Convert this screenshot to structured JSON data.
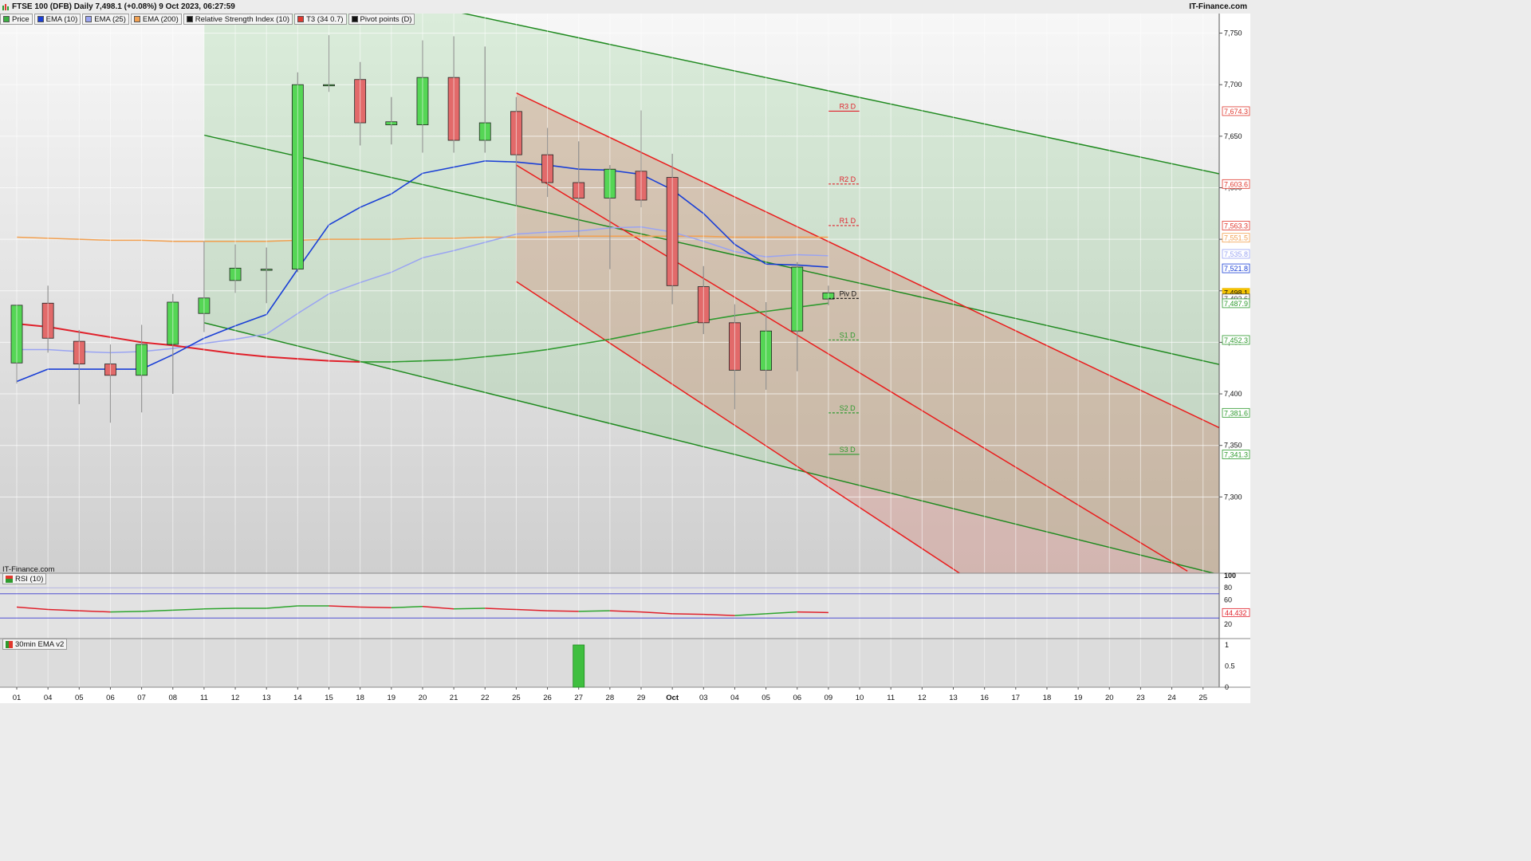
{
  "header": {
    "title": "FTSE 100 (DFB) Daily 7,498.1 (+0.08%) 9 Oct 2023, 06:27:59",
    "brand": "IT-Finance.com"
  },
  "legend": [
    {
      "label": "Price",
      "color": "#3cb043"
    },
    {
      "label": "EMA (10)",
      "color": "#1a3fd6"
    },
    {
      "label": "EMA (25)",
      "color": "#9aa4f2"
    },
    {
      "label": "EMA (200)",
      "color": "#f2a050"
    },
    {
      "label": "Relative Strength Index (10)",
      "color": "#111111"
    },
    {
      "label": "T3 (34 0.7)",
      "color": "#e0382e"
    },
    {
      "label": "Pivot points (D)",
      "color": "#111111"
    }
  ],
  "watermark": "IT-Finance.com",
  "colors": {
    "bull": "#55d655",
    "bear": "#e26a6a",
    "ema10": "#1a3fd6",
    "ema25": "#9aa4f2",
    "ema200": "#f2a050",
    "t3_up": "#2e9a2e",
    "t3_down": "#e0202a",
    "green_channel": "#1f8a1f",
    "red_channel": "#ea1c1c"
  },
  "chart_data": [
    {
      "type": "candlestick",
      "name": "price",
      "title": "FTSE 100 (DFB) Daily",
      "x_ticks": [
        "01",
        "04",
        "05",
        "06",
        "07",
        "08",
        "11",
        "12",
        "13",
        "14",
        "15",
        "18",
        "19",
        "20",
        "21",
        "22",
        "25",
        "26",
        "27",
        "28",
        "29",
        "Oct",
        "03",
        "04",
        "05",
        "06",
        "09",
        "10",
        "11",
        "12",
        "13",
        "16",
        "17",
        "18",
        "19",
        "20",
        "23",
        "24",
        "25"
      ],
      "y_ticks": [
        "7,300",
        "7,350",
        "7,400",
        "7,450",
        "7,500",
        "7,550",
        "7,600",
        "7,650",
        "7,700",
        "7,750"
      ],
      "ylim": [
        7226,
        7769
      ],
      "candles": [
        {
          "o": 7430,
          "h": 7470,
          "l": 7410,
          "c": 7486
        },
        {
          "o": 7488,
          "h": 7505,
          "l": 7440,
          "c": 7454
        },
        {
          "o": 7451,
          "h": 7462,
          "l": 7390,
          "c": 7429
        },
        {
          "o": 7429,
          "h": 7448,
          "l": 7372,
          "c": 7418
        },
        {
          "o": 7418,
          "h": 7467,
          "l": 7382,
          "c": 7448
        },
        {
          "o": 7448,
          "h": 7497,
          "l": 7400,
          "c": 7489
        },
        {
          "o": 7478,
          "h": 7548,
          "l": 7460,
          "c": 7493
        },
        {
          "o": 7510,
          "h": 7545,
          "l": 7498,
          "c": 7522
        },
        {
          "o": 7520,
          "h": 7542,
          "l": 7488,
          "c": 7521
        },
        {
          "o": 7521,
          "h": 7712,
          "l": 7518,
          "c": 7700
        },
        {
          "o": 7700,
          "h": 7748,
          "l": 7693,
          "c": 7700
        },
        {
          "o": 7705,
          "h": 7722,
          "l": 7641,
          "c": 7663
        },
        {
          "o": 7661,
          "h": 7688,
          "l": 7642,
          "c": 7664
        },
        {
          "o": 7661,
          "h": 7743,
          "l": 7634,
          "c": 7707
        },
        {
          "o": 7707,
          "h": 7747,
          "l": 7634,
          "c": 7646
        },
        {
          "o": 7646,
          "h": 7737,
          "l": 7634,
          "c": 7663
        },
        {
          "o": 7674,
          "h": 7688,
          "l": 7582,
          "c": 7632
        },
        {
          "o": 7632,
          "h": 7658,
          "l": 7591,
          "c": 7605
        },
        {
          "o": 7605,
          "h": 7645,
          "l": 7552,
          "c": 7590
        },
        {
          "o": 7590,
          "h": 7622,
          "l": 7521,
          "c": 7618
        },
        {
          "o": 7616,
          "h": 7675,
          "l": 7581,
          "c": 7588
        },
        {
          "o": 7610,
          "h": 7633,
          "l": 7487,
          "c": 7505
        },
        {
          "o": 7504,
          "h": 7524,
          "l": 7458,
          "c": 7469
        },
        {
          "o": 7469,
          "h": 7487,
          "l": 7385,
          "c": 7423
        },
        {
          "o": 7423,
          "h": 7489,
          "l": 7404,
          "c": 7461
        },
        {
          "o": 7461,
          "h": 7528,
          "l": 7422,
          "c": 7523
        },
        {
          "o": 7492,
          "h": 7505,
          "l": 7486,
          "c": 7498
        }
      ],
      "ema10": [
        7412,
        7424,
        7424,
        7424,
        7424,
        7438,
        7454,
        7466,
        7477,
        7521,
        7564,
        7581,
        7594,
        7614,
        7620,
        7626,
        7625,
        7622,
        7618,
        7617,
        7613,
        7598,
        7575,
        7545,
        7526,
        7525,
        7523
      ],
      "ema25": [
        7443,
        7443,
        7441,
        7440,
        7441,
        7444,
        7449,
        7453,
        7458,
        7478,
        7497,
        7508,
        7518,
        7532,
        7539,
        7547,
        7555,
        7557,
        7558,
        7561,
        7562,
        7557,
        7548,
        7538,
        7533,
        7535,
        7534
      ],
      "ema200": [
        7552,
        7551,
        7550,
        7549,
        7549,
        7548,
        7548,
        7548,
        7548,
        7549,
        7550,
        7550,
        7550,
        7551,
        7551,
        7552,
        7552,
        7552,
        7553,
        7553,
        7553,
        7553,
        7553,
        7552,
        7552,
        7552,
        7552
      ],
      "t3": [
        7468,
        7465,
        7460,
        7455,
        7450,
        7447,
        7443,
        7439,
        7436,
        7434,
        7432,
        7431,
        7431,
        7432,
        7433,
        7436,
        7439,
        7443,
        7448,
        7453,
        7459,
        7465,
        7471,
        7476,
        7480,
        7484,
        7488
      ],
      "t3_up_from_index": 11,
      "pivots": [
        {
          "label": "R3 D",
          "value": 7674.3,
          "type": "resistance"
        },
        {
          "label": "R2 D",
          "value": 7603.6,
          "type": "resistance"
        },
        {
          "label": "R1 D",
          "value": 7563.3,
          "type": "resistance"
        },
        {
          "label": "Piv D",
          "value": 7492.6,
          "type": "pivot"
        },
        {
          "label": "S1 D",
          "value": 7452.3,
          "type": "support"
        },
        {
          "label": "S2 D",
          "value": 7381.6,
          "type": "support"
        },
        {
          "label": "S3 D",
          "value": 7341.3,
          "type": "support"
        }
      ],
      "price_tags": [
        {
          "text": "7,674.3",
          "value": 7674.3,
          "color": "#e0382e"
        },
        {
          "text": "7,603.6",
          "value": 7603.6,
          "color": "#e0382e"
        },
        {
          "text": "7,563.3",
          "value": 7563.3,
          "color": "#e0382e"
        },
        {
          "text": "7,551.5",
          "value": 7551.5,
          "color": "#f2a050"
        },
        {
          "text": "7,535.8",
          "value": 7535.8,
          "color": "#9aa4f2"
        },
        {
          "text": "7,521.8",
          "value": 7521.8,
          "color": "#1a3fd6"
        },
        {
          "text": "7,498.1",
          "value": 7498.1,
          "color": "#e8b400"
        },
        {
          "text": "7,492.6",
          "value": 7492.6,
          "color": "#444444"
        },
        {
          "text": "7,487.9",
          "value": 7487.9,
          "color": "#2e9a2e"
        },
        {
          "text": "7,452.3",
          "value": 7452.3,
          "color": "#2e9a2e"
        },
        {
          "text": "7,381.6",
          "value": 7381.6,
          "color": "#2e9a2e"
        },
        {
          "text": "7,341.3",
          "value": 7341.3,
          "color": "#2e9a2e"
        }
      ],
      "green_channel": {
        "upper": [
          {
            "i": 13.1,
            "v": 7777
          },
          {
            "i": 38.6,
            "v": 7613
          }
        ],
        "middle": [
          {
            "i": 6,
            "v": 7651
          },
          {
            "i": 38.6,
            "v": 7428
          }
        ],
        "lower": [
          {
            "i": 6,
            "v": 7469
          },
          {
            "i": 38.6,
            "v": 7224
          }
        ],
        "shade_from_index": 6
      },
      "red_channel": {
        "upper": [
          {
            "i": 16,
            "v": 7692
          },
          {
            "i": 38.6,
            "v": 7366
          }
        ],
        "middle": [
          {
            "i": 16,
            "v": 7622
          },
          {
            "i": 37.5,
            "v": 7228
          }
        ],
        "lower": [
          {
            "i": 16,
            "v": 7509
          },
          {
            "i": 30.2,
            "v": 7226
          }
        ],
        "shade_from_index": 16
      }
    },
    {
      "type": "line",
      "name": "rsi",
      "title": "RSI (10)",
      "y_ticks": [
        "20",
        "60",
        "80",
        "100"
      ],
      "ylim": [
        0,
        100
      ],
      "bands": [
        30,
        70
      ],
      "values": [
        48,
        44,
        42,
        40,
        41,
        43,
        45,
        46,
        46,
        50,
        50,
        48,
        47,
        49,
        45,
        46,
        44,
        42,
        41,
        42,
        40,
        37,
        36,
        34,
        37,
        40,
        39
      ],
      "last_label": "44.432"
    },
    {
      "type": "bar",
      "name": "ema30",
      "title": "30min EMA v2",
      "y_ticks": [
        "0",
        "0.5",
        "1"
      ],
      "ylim": [
        0,
        1
      ],
      "values": [
        0,
        0,
        0,
        0,
        0,
        0,
        0,
        0,
        0,
        0,
        0,
        0,
        0,
        0,
        0,
        0,
        0,
        0,
        1,
        0,
        0,
        0,
        0,
        0,
        0,
        0,
        0
      ]
    }
  ]
}
